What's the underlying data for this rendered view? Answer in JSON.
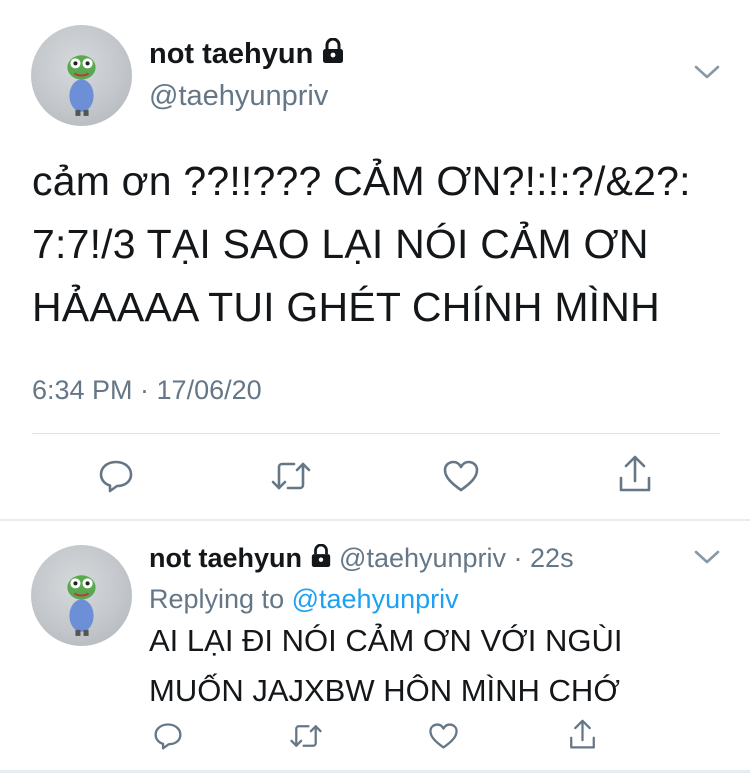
{
  "main_tweet": {
    "display_name": "not taehyun",
    "handle": "@taehyunpriv",
    "protected_icon": "lock-icon",
    "text_lines": [
      "cảm ơn ??!!??? CẢM ƠN?!:!:?/&2?:",
      "7:7!/3 TẠI SAO LẠI NÓI CẢM ƠN",
      "HẢAAAA TUI GHÉT CHÍNH MÌNH"
    ],
    "timestamp": "6:34 PM · 17/06/20",
    "actions": [
      "reply-icon",
      "retweet-icon",
      "like-icon",
      "share-icon"
    ],
    "menu_icon": "chevron-down-icon"
  },
  "reply_tweet": {
    "display_name": "not taehyun",
    "handle": "@taehyunpriv",
    "age": "· 22s",
    "replying_prefix": "Replying to",
    "replying_to": "@taehyunpriv",
    "text_lines": [
      "AI LẠI ĐI NÓI CẢM ƠN VỚI NGÙI",
      "MUỐN JAJXBW HÔN MÌNH CHỚ"
    ],
    "actions": [
      "reply-icon",
      "retweet-icon",
      "like-icon",
      "share-icon"
    ],
    "menu_icon": "chevron-down-icon"
  },
  "colors": {
    "text": "#14171a",
    "secondary": "#657786",
    "link": "#1da1f2",
    "divider": "#e6ecf0"
  }
}
